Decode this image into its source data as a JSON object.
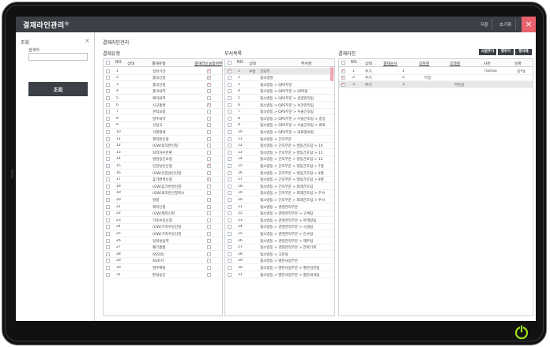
{
  "window": {
    "title": "결재라인관리",
    "save_label": "저장",
    "reset_label": "초기화",
    "close_label": "×"
  },
  "search": {
    "title": "조회",
    "close_label": "×",
    "field_label": "검색어",
    "input_value": "",
    "button_label": "조회"
  },
  "main_title": "결재라인관리",
  "approval_types": {
    "title": "결재유형",
    "columns": [
      "NO.",
      "상태",
      "결재유형",
      "결재라인설정여부"
    ],
    "rows": [
      {
        "no": "1",
        "type": "일반기안",
        "set": true
      },
      {
        "no": "2",
        "type": "품의신청",
        "set": true
      },
      {
        "no": "3",
        "type": "품의신청",
        "set": true
      },
      {
        "no": "4",
        "type": "품의내역",
        "set": false
      },
      {
        "no": "5",
        "type": "매각내역",
        "set": false
      },
      {
        "no": "6",
        "type": "신규품명",
        "set": true
      },
      {
        "no": "7",
        "type": "견적요청",
        "set": false
      },
      {
        "no": "8",
        "type": "발주내역",
        "set": false
      },
      {
        "no": "9",
        "type": "선입고",
        "set": false
      },
      {
        "no": "10",
        "type": "거래명세",
        "set": false
      },
      {
        "no": "11",
        "type": "제작완신청",
        "set": false
      },
      {
        "no": "12",
        "type": "(GW)퇴직완신청",
        "set": false
      },
      {
        "no": "13",
        "type": "퇴직자수반환",
        "set": false
      },
      {
        "no": "14",
        "type": "병원승인요청",
        "set": false
      },
      {
        "no": "15",
        "type": "인장날인신청",
        "set": true
      },
      {
        "no": "16",
        "type": "(GW)인장날인신청",
        "set": false
      },
      {
        "no": "17",
        "type": "휴가변경신청",
        "set": true
      },
      {
        "no": "18",
        "type": "(GW)휴가변경신청",
        "set": false
      },
      {
        "no": "19",
        "type": "(GW)퇴직완신청취소",
        "set": false
      },
      {
        "no": "20",
        "type": "발령",
        "set": false
      },
      {
        "no": "21",
        "type": "제작신청",
        "set": false
      },
      {
        "no": "22",
        "type": "(GW)제작신청",
        "set": false
      },
      {
        "no": "23",
        "type": "가족수당신청",
        "set": false
      },
      {
        "no": "24",
        "type": "(GW)가족수당신청",
        "set": false
      },
      {
        "no": "25",
        "type": "(GW)가족수당신청",
        "set": false
      },
      {
        "no": "26",
        "type": "일회성용역",
        "set": false
      },
      {
        "no": "27",
        "type": "폐기품품",
        "set": false
      },
      {
        "no": "28",
        "type": "AS의뢰",
        "set": false
      },
      {
        "no": "29",
        "type": "AS조치",
        "set": false
      },
      {
        "no": "30",
        "type": "발주확정",
        "set": false
      },
      {
        "no": "31",
        "type": "판설승인",
        "set": false
      }
    ]
  },
  "departments": {
    "title": "부서목록",
    "columns": [
      "NO.",
      "상태",
      "부서명"
    ],
    "rows": [
      {
        "no": "1",
        "status": "수정",
        "name": "간호부"
      },
      {
        "no": "2",
        "status": "",
        "name": "협소병원"
      },
      {
        "no": "3",
        "status": "",
        "name": "협소병동 > QPS부문"
      },
      {
        "no": "4",
        "status": "",
        "name": "협소병동 > QPS부문 > QPS팀"
      },
      {
        "no": "5",
        "status": "",
        "name": "협소병동 > QPS부문 > 감염관리팀"
      },
      {
        "no": "6",
        "status": "",
        "name": "협소병동 > QPS부문 > 보건관리팀"
      },
      {
        "no": "7",
        "status": "",
        "name": "협소병동 > QPS부문 > 수술간호팀"
      },
      {
        "no": "8",
        "status": "",
        "name": "협소병동 > QPS부문 > 수술간호팀 > 중앙"
      },
      {
        "no": "9",
        "status": "",
        "name": "협소병동 > QPS부문 > 수술간호팀 > 회복"
      },
      {
        "no": "10",
        "status": "",
        "name": "협소병동 > QPS부문 > 의료정보팀"
      },
      {
        "no": "11",
        "status": "",
        "name": "협소병동 > 간호부문"
      },
      {
        "no": "12",
        "status": "",
        "name": "협소병동 > 간호부문 > 병동간호팀 > 10"
      },
      {
        "no": "13",
        "status": "",
        "name": "협소병동 > 간호부문 > 병동간호팀 > 11"
      },
      {
        "no": "14",
        "status": "",
        "name": "협소병동 > 간호부문 > 병동간호팀 > 12"
      },
      {
        "no": "15",
        "status": "",
        "name": "협소병동 > 간호부문 > 병동간호팀 > 7병"
      },
      {
        "no": "16",
        "status": "",
        "name": "협소병동 > 간호부문 > 병동간호팀 > 8병"
      },
      {
        "no": "17",
        "status": "",
        "name": "협소병동 > 간호부문 > 병동간호팀 > 9병"
      },
      {
        "no": "18",
        "status": "",
        "name": "협소병동 > 간호부문 > 외래간호팀"
      },
      {
        "no": "19",
        "status": "",
        "name": "협소병동 > 간호부문 > 외래간호팀 > 주사"
      },
      {
        "no": "20",
        "status": "",
        "name": "협소병동 > 간호부문 > 외래간호팀 > 주사"
      },
      {
        "no": "21",
        "status": "",
        "name": "협소병동 > 경영관리부문"
      },
      {
        "no": "22",
        "status": "",
        "name": "협소병동 > 경영관리부문 > 구매팀"
      },
      {
        "no": "23",
        "status": "",
        "name": "협소병동 > 경영관리부문 > 마케팅팀"
      },
      {
        "no": "24",
        "status": "",
        "name": "협소병동 > 경영관리부문 > 시설팀"
      },
      {
        "no": "25",
        "status": "",
        "name": "협소병동 > 경영관리부문 > 인사팀"
      },
      {
        "no": "26",
        "status": "",
        "name": "협소병동 > 경영관리부문 > 재무팀"
      },
      {
        "no": "27",
        "status": "",
        "name": "협소병동 > 경영관리부문 > 전략기획"
      },
      {
        "no": "28",
        "status": "",
        "name": "협소병동 > 고문실"
      },
      {
        "no": "29",
        "status": "",
        "name": "협소병동 > 별관사업부문"
      },
      {
        "no": "30",
        "status": "",
        "name": "협소병동 > 별관사업부문 > 별관검진팀"
      },
      {
        "no": "31",
        "status": "",
        "name": "협소병동 > 별관사업부문 > 별관내과팀"
      }
    ]
  },
  "approval_line": {
    "title": "결재라인",
    "buttons": [
      "사원추가",
      "행추가",
      "행삭제"
    ],
    "columns": [
      "NO.",
      "상태",
      "결재순서",
      "직위명",
      "직책명",
      "사번",
      "성명"
    ],
    "rows": [
      {
        "no": "1",
        "status": "추가",
        "order": "1",
        "position": "",
        "role": "",
        "empno": "rlamao",
        "name": "김*태"
      },
      {
        "no": "2",
        "status": "추가",
        "order": "2",
        "position": "부장",
        "role": "",
        "empno": "",
        "name": ""
      },
      {
        "no": "3",
        "status": "추가",
        "order": "3",
        "position": "",
        "role": "부문장",
        "empno": "",
        "name": ""
      }
    ]
  }
}
